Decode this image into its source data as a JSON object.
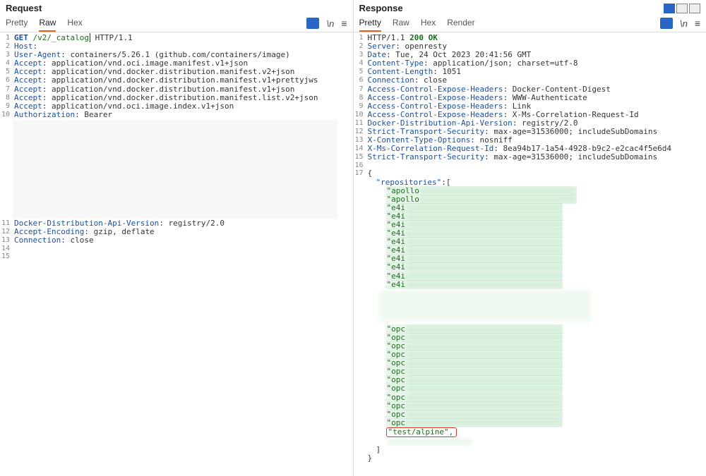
{
  "request": {
    "title": "Request",
    "tabs": {
      "pretty": "Pretty",
      "raw": "Raw",
      "hex": "Hex"
    },
    "lines": {
      "l1_method": "GET",
      "l1_path": "/v2/_catalog",
      "l1_proto": " HTTP/1.1",
      "l2_k": "Host",
      "l2_v": " ",
      "l3_k": "User-Agent",
      "l3_v": " containers/5.26.1 (github.com/containers/image)",
      "l4_k": "Accept",
      "l4_v": " application/vnd.oci.image.manifest.v1+json",
      "l5_k": "Accept",
      "l5_v": " application/vnd.docker.distribution.manifest.v2+json",
      "l6_k": "Accept",
      "l6_v": " application/vnd.docker.distribution.manifest.v1+prettyjws",
      "l7_k": "Accept",
      "l7_v": " application/vnd.docker.distribution.manifest.v1+json",
      "l8_k": "Accept",
      "l8_v": " application/vnd.docker.distribution.manifest.list.v2+json",
      "l9_k": "Accept",
      "l9_v": " application/vnd.oci.image.index.v1+json",
      "l10_k": "Authorization",
      "l10_v": " Bearer ",
      "l11_k": "Docker-Distribution-Api-Version",
      "l11_v": " registry/2.0",
      "l12_k": "Accept-Encoding",
      "l12_v": " gzip, deflate",
      "l13_k": "Connection",
      "l13_v": " close"
    }
  },
  "response": {
    "title": "Response",
    "tabs": {
      "pretty": "Pretty",
      "raw": "Raw",
      "hex": "Hex",
      "render": "Render"
    },
    "lines": {
      "l1_proto": "HTTP/1.1 ",
      "l1_status": "200 OK",
      "l2_k": "Server",
      "l2_v": " openresty",
      "l3_k": "Date",
      "l3_v": " Tue, 24 Oct 2023 20:41:56 GMT",
      "l4_k": "Content-Type",
      "l4_v": " application/json; charset=utf-8",
      "l5_k": "Content-Length",
      "l5_v": " 1051",
      "l6_k": "Connection",
      "l6_v": " close",
      "l7_k": "Access-Control-Expose-Headers",
      "l7_v": " Docker-Content-Digest",
      "l8_k": "Access-Control-Expose-Headers",
      "l8_v": " WWW-Authenticate",
      "l9_k": "Access-Control-Expose-Headers",
      "l9_v": " Link",
      "l10_k": "Access-Control-Expose-Headers",
      "l10_v": " X-Ms-Correlation-Request-Id",
      "l11_k": "Docker-Distribution-Api-Version",
      "l11_v": " registry/2.0",
      "l12_k": "Strict-Transport-Security",
      "l12_v": " max-age=31536000; includeSubDomains",
      "l13_k": "X-Content-Type-Options",
      "l13_v": " nosniff",
      "l14_k": "X-Ms-Correlation-Request-Id",
      "l14_v": " 8ea94b17-1a54-4928-b9c2-e2cac4f5e6d4",
      "l15_k": "Strict-Transport-Security",
      "l15_v": " max-age=31536000; includeSubDomains",
      "repos_key": "\"repositories\"",
      "apollo": "\"apollo",
      "e4i": "\"e4i",
      "opc": "\"opc",
      "test_alpine": "\"test/alpine\",",
      "brace_open": "{",
      "bracket_open": ":[",
      "bracket_close": "]",
      "brace_close": "}"
    }
  }
}
